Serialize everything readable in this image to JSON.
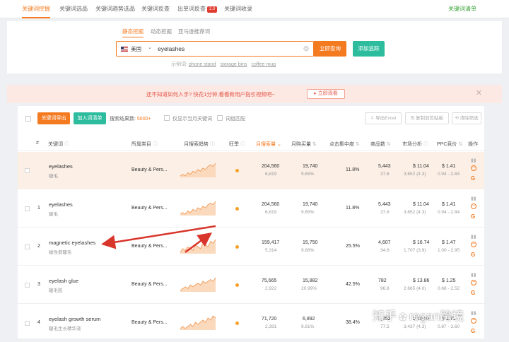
{
  "topnav": {
    "tabs": [
      {
        "label": "关键词挖掘",
        "active": true
      },
      {
        "label": "关键词选品",
        "active": false
      },
      {
        "label": "关键词趋势选品",
        "active": false
      },
      {
        "label": "关键词反查",
        "active": false
      },
      {
        "label": "出单词反查",
        "active": false,
        "badge": "2.0"
      },
      {
        "label": "关键词收录",
        "active": false
      }
    ],
    "right_link": "关键词清单"
  },
  "search": {
    "modes": [
      "静态挖掘",
      "动态挖掘",
      "亚马逊推荐词"
    ],
    "active_mode": "静态挖掘",
    "country": "美国",
    "keyword_value": "eyelashes",
    "query_button": "立即查询",
    "track_button": "添加追踪",
    "examples_label": "示例词:",
    "examples": [
      "phone stand",
      "storage bins",
      "coffee mug"
    ]
  },
  "banner": {
    "text": "还不知道如何入手? 快花1分钟,看看新用户指引视频吧~",
    "button": "立即观看"
  },
  "toolbar": {
    "export_button": "关键词导出",
    "add_button": "加入词清单",
    "result_label": "搜索结果数:",
    "result_count": "5000+",
    "option_current_month": "仅显示当月关键词",
    "option_exact_match": "词组匹配",
    "export_excel": "导出Excel",
    "copy_keywords": "复制到剪贴板",
    "reset": "清除筛选"
  },
  "table": {
    "headers": [
      "#",
      "关键词",
      "所属类目",
      "月搜索趋势",
      "旺季",
      "月搜索量",
      "月购买量",
      "点击集中度",
      "商品数",
      "市场分析",
      "PPC竞价",
      "操作"
    ],
    "rows": [
      {
        "num": "",
        "kw": "eyelashes",
        "kw_cn": "睫毛",
        "cat": "Beauty & Pers...",
        "search": "204,560",
        "search_sub": "6,819",
        "buy": "19,740",
        "buy_sub": "9.65%",
        "click": "11.8%",
        "products": "5,443",
        "products_sub": "37.6",
        "price": "$ 11.04",
        "price_sub": "3,652 (4.3)",
        "ppc": "$ 1.41",
        "ppc_sub": "0.94 - 2.84",
        "trend": [
          5,
          6,
          5,
          7,
          6,
          8,
          7,
          9,
          8,
          10,
          9,
          11,
          12,
          11,
          13
        ]
      },
      {
        "num": "1",
        "kw": "eyelashes",
        "kw_cn": "睫毛",
        "cat": "Beauty & Pers...",
        "search": "204,560",
        "search_sub": "6,819",
        "buy": "19,740",
        "buy_sub": "9.65%",
        "click": "11.8%",
        "products": "5,443",
        "products_sub": "37.6",
        "price": "$ 11.04",
        "price_sub": "3,652 (4.3)",
        "ppc": "$ 1.41",
        "ppc_sub": "0.94 - 2.84",
        "trend": [
          5,
          6,
          5,
          7,
          6,
          8,
          7,
          9,
          8,
          10,
          9,
          11,
          12,
          11,
          13
        ]
      },
      {
        "num": "2",
        "kw": "magnetic eyelashes",
        "kw_cn": "磁性假睫毛",
        "cat": "Beauty & Pers...",
        "search": "159,417",
        "search_sub": "5,314",
        "buy": "15,750",
        "buy_sub": "9.88%",
        "click": "25.5%",
        "products": "4,607",
        "products_sub": "34.6",
        "price": "$ 16.74",
        "price_sub": "1,707 (3.9)",
        "ppc": "$ 1.47",
        "ppc_sub": "1.00 - 2.95",
        "trend": [
          3,
          5,
          4,
          6,
          5,
          4,
          7,
          6,
          5,
          8,
          7,
          6,
          9,
          8,
          10
        ]
      },
      {
        "num": "3",
        "kw": "eyelash glue",
        "kw_cn": "睫毛胶",
        "cat": "Beauty & Pers...",
        "search": "75,665",
        "search_sub": "2,922",
        "buy": "15,882",
        "buy_sub": "20.99%",
        "click": "42.5%",
        "products": "782",
        "products_sub": "96.8",
        "price": "$ 13.86",
        "price_sub": "2,665 (4.0)",
        "ppc": "$ 1.25",
        "ppc_sub": "0.68 - 2.52",
        "trend": [
          4,
          5,
          6,
          5,
          7,
          6,
          7,
          8,
          7,
          9,
          8,
          9,
          10,
          9,
          11
        ]
      },
      {
        "num": "4",
        "kw": "eyelash growth serum",
        "kw_cn": "睫毛生长精华液",
        "cat": "Beauty & Pers...",
        "search": "71,720",
        "search_sub": "2,391",
        "buy": "6,892",
        "buy_sub": "9.61%",
        "click": "38.4%",
        "products": "1,252",
        "products_sub": "77.5",
        "price": "$ 19.06",
        "price_sub": "3,437 (4.3)",
        "ppc": "$ 1.71",
        "ppc_sub": "0.87 - 3.60",
        "trend": [
          5,
          6,
          5,
          6,
          7,
          6,
          8,
          7,
          8,
          9,
          8,
          10,
          9,
          11,
          10
        ]
      }
    ]
  },
  "watermark": {
    "left": "知乎",
    "right": "regan跨境"
  },
  "colors": {
    "accent": "#f47a20",
    "teal": "#2dbc9e",
    "arrow": "#d8352b"
  }
}
